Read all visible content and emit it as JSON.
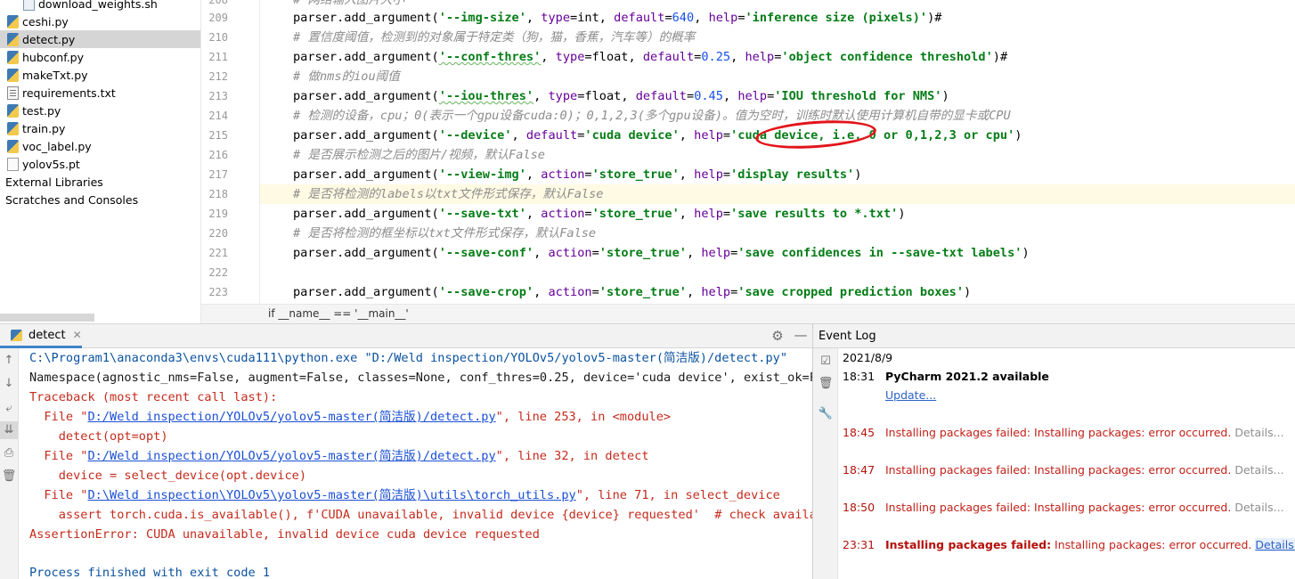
{
  "project_tree": {
    "items": [
      {
        "label": "download_weights.sh",
        "icon": "shell-file-icon"
      },
      {
        "label": "ceshi.py",
        "icon": "python-file-icon"
      },
      {
        "label": "detect.py",
        "icon": "python-file-icon"
      },
      {
        "label": "hubconf.py",
        "icon": "python-file-icon"
      },
      {
        "label": "makeTxt.py",
        "icon": "python-file-icon"
      },
      {
        "label": "requirements.txt",
        "icon": "text-file-icon"
      },
      {
        "label": "test.py",
        "icon": "python-file-icon"
      },
      {
        "label": "train.py",
        "icon": "python-file-icon"
      },
      {
        "label": "voc_label.py",
        "icon": "python-file-icon"
      },
      {
        "label": "yolov5s.pt",
        "icon": "binary-file-icon"
      },
      {
        "label": "External Libraries",
        "icon": ""
      },
      {
        "label": "Scratches and Consoles",
        "icon": ""
      }
    ]
  },
  "editor": {
    "line_numbers": [
      "208",
      "209",
      "210",
      "211",
      "212",
      "213",
      "214",
      "215",
      "216",
      "217",
      "218",
      "219",
      "220",
      "221",
      "222",
      "223"
    ],
    "current_line": "218",
    "breadcrumb": "if __name__ == '__main__'",
    "c208": "# 网络输入图片大小",
    "l209": {
      "a": "parser.add_argument(",
      "b": "'--img-size'",
      "c": ", ",
      "d": "type",
      "e": "=int, ",
      "f": "default",
      "g": "=",
      "h": "640",
      "i": ", ",
      "j": "help",
      "k": "=",
      "l": "'inference size (pixels)'",
      "m": ")#"
    },
    "c210": "# 置信度阈值，检测到的对象属于特定类（狗，猫，香蕉，汽车等）的概率",
    "l211": {
      "a": "parser.add_argument(",
      "b": "'--conf-thres'",
      "c": ", ",
      "d": "type",
      "e": "=float, ",
      "f": "default",
      "g": "=",
      "h": "0.25",
      "i": ", ",
      "j": "help",
      "k": "=",
      "l": "'object confidence threshold'",
      "m": ")#"
    },
    "c212": "# 做nms的iou阈值",
    "l213": {
      "a": "parser.add_argument(",
      "b": "'--iou-thres'",
      "c": ", ",
      "d": "type",
      "e": "=float, ",
      "f": "default",
      "g": "=",
      "h": "0.45",
      "i": ", ",
      "j": "help",
      "k": "=",
      "l": "'IOU threshold for NMS'",
      "m": ")"
    },
    "c214": "# 检测的设备，cpu；0(表示一个gpu设备cuda:0)；0,1,2,3(多个gpu设备)。值为空时，训练时默认使用计算机自带的显卡或CPU",
    "l215": {
      "a": "parser.add_argument(",
      "b": "'--device'",
      "c": ", ",
      "f": "default",
      "g": "=",
      "h": "'cuda device'",
      "i": ", ",
      "j": "help",
      "k": "=",
      "l": "'cuda device, i.e. 0 or 0,1,2,3 or cpu'",
      "m": ")"
    },
    "c216": "# 是否展示检测之后的图片/视频，默认False",
    "l217": {
      "a": "parser.add_argument(",
      "b": "'--view-img'",
      "c": ", ",
      "d": "action",
      "e": "=",
      "h": "'store_true'",
      "i": ", ",
      "j": "help",
      "k": "=",
      "l": "'display results'",
      "m": ")"
    },
    "c218": "# 是否将检测的labels以txt文件形式保存，默认False",
    "l219": {
      "a": "parser.add_argument(",
      "b": "'--save-txt'",
      "c": ", ",
      "d": "action",
      "e": "=",
      "h": "'store_true'",
      "i": ", ",
      "j": "help",
      "k": "=",
      "l": "'save results to *.txt'",
      "m": ")"
    },
    "c220": "# 是否将检测的框坐标以txt文件形式保存，默认False",
    "l221": {
      "a": "parser.add_argument(",
      "b": "'--save-conf'",
      "c": ", ",
      "d": "action",
      "e": "=",
      "h": "'store_true'",
      "i": ", ",
      "j": "help",
      "k": "=",
      "l": "'save confidences in --save-txt labels'",
      "m": ")"
    },
    "l223": {
      "a": "parser.add_argument(",
      "b": "'--save-crop'",
      "c": ", ",
      "d": "action",
      "e": "=",
      "h": "'store_true'",
      "i": ", ",
      "j": "help",
      "k": "=",
      "l": "'save cropped prediction boxes'",
      "m": ")"
    }
  },
  "run_panel": {
    "tab_label": "detect",
    "lines": {
      "cmd": "C:\\Program1\\anaconda3\\envs\\cuda111\\python.exe \"D:/Weld inspection/YOLOv5/yolov5-master(简洁版)/detect.py\"",
      "ns": "Namespace(agnostic_nms=False, augment=False, classes=None, conf_thres=0.25, device='cuda device', exist_ok=False",
      "tb": "Traceback (most recent call last):",
      "f1_pre": "  File \"",
      "f1_link": "D:/Weld inspection/YOLOv5/yolov5-master(简洁版)/detect.py",
      "f1_post": "\", line 253, in <module>",
      "f1_code": "    detect(opt=opt)",
      "f2_pre": "  File \"",
      "f2_link": "D:/Weld inspection/YOLOv5/yolov5-master(简洁版)/detect.py",
      "f2_post": "\", line 32, in detect",
      "f2_code": "    device = select_device(opt.device)",
      "f3_pre": "  File \"",
      "f3_link": "D:\\Weld inspection\\YOLOv5\\yolov5-master(简洁版)\\utils\\torch_utils.py",
      "f3_post": "\", line 71, in select_device",
      "f3_code": "    assert torch.cuda.is_available(), f'CUDA unavailable, invalid device {device} requested'  # check availability",
      "err": "AssertionError: CUDA unavailable, invalid device cuda device requested",
      "exit": "Process finished with exit code 1"
    }
  },
  "event_log": {
    "title": "Event Log",
    "date": "2021/8/9",
    "entries": [
      {
        "time": "18:31",
        "title": "PyCharm 2021.2 available",
        "link": "Update..."
      },
      {
        "time": "18:45",
        "message": "Installing packages failed: Installing packages: error occurred.",
        "details": "Details..."
      },
      {
        "time": "18:47",
        "message": "Installing packages failed: Installing packages: error occurred.",
        "details": "Details..."
      },
      {
        "time": "18:50",
        "message": "Installing packages failed: Installing packages: error occurred.",
        "details": "Details..."
      },
      {
        "time": "23:31",
        "bold": "Installing packages failed:",
        "message": " Installing packages: error occurred.",
        "details": "Details..."
      }
    ]
  },
  "colors": {
    "annotation_circle": "#e2141a",
    "error_red": "#c42b1c",
    "link_blue": "#1a4fd4",
    "current_line_bg": "#fffae3"
  }
}
